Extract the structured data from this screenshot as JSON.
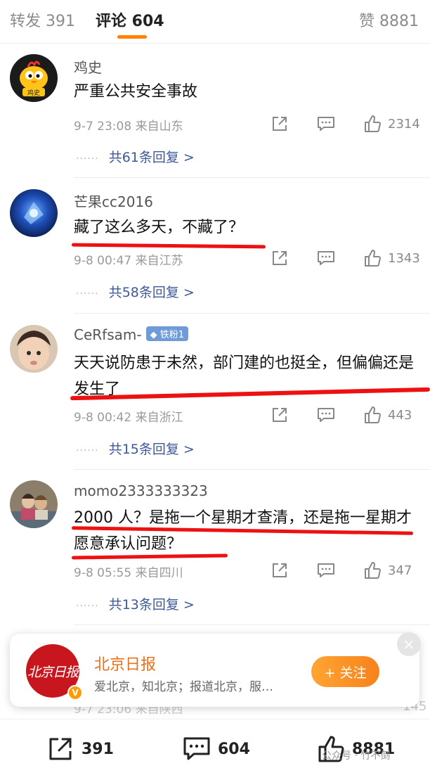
{
  "tabs": {
    "forward": "转发 391",
    "comment": "评论 604",
    "like": "赞 8881"
  },
  "comments": [
    {
      "username": "鸡史",
      "avatar_text": "鸡史",
      "text": "严重公共安全事故",
      "meta": "9-7 23:08  来自山东",
      "likes": "2314",
      "replies": "共61条回复 >"
    },
    {
      "username": "芒果cc2016",
      "text": "藏了这么多天，不藏了？",
      "meta": "9-8 00:47  来自江苏",
      "likes": "1343",
      "replies": "共58条回复 >"
    },
    {
      "username": "CeRfsam-",
      "badge": "铁粉1",
      "text": "天天说防患于未然，部门建的也挺全，但偏偏还是发生了",
      "meta": "9-8 00:42  来自浙江",
      "likes": "443",
      "replies": "共15条回复 >"
    },
    {
      "username": "momo2333333323",
      "text": "2000 人？是拖一个星期才查清，还是拖一星期才愿意承认问题？",
      "meta": "9-8 05:55  来自四川",
      "likes": "347",
      "replies": "共13条回复 >"
    }
  ],
  "ghost_comment": {
    "meta": "9-7 23:06  来自陕西",
    "likes": "145"
  },
  "follow_card": {
    "logo_text": "北京日报",
    "title": "北京日报",
    "description": "爱北京，知北京；报道北京，服…",
    "follow_label": "+ 关注",
    "close": "×"
  },
  "bottom_bar": {
    "forward_count": "391",
    "comment_count": "604",
    "like_count": "8881"
  },
  "watermark": "公众号 · 竹不倒",
  "colors": {
    "accent": "#ff8200",
    "link": "#3d5a96",
    "annotation": "#ee1111"
  }
}
